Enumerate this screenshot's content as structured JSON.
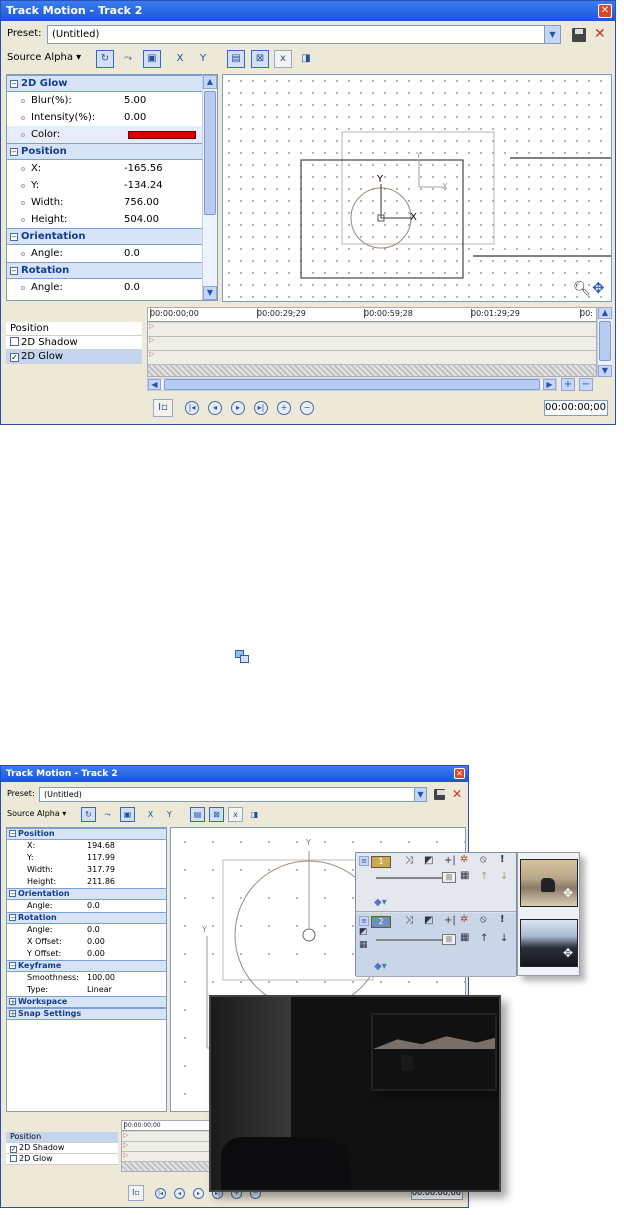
{
  "top_window": {
    "title": "Track Motion - Track 2",
    "preset_label": "Preset:",
    "preset_value": "(Untitled)",
    "source_alpha_label": "Source Alpha",
    "sections": [
      {
        "title": "2D Glow",
        "rows": [
          {
            "label": "Blur(%):",
            "value": "5.00"
          },
          {
            "label": "Intensity(%):",
            "value": "0.00"
          },
          {
            "label": "Color:",
            "value": ""
          }
        ]
      },
      {
        "title": "Position",
        "rows": [
          {
            "label": "X:",
            "value": "-165.56"
          },
          {
            "label": "Y:",
            "value": "-134.24"
          },
          {
            "label": "Width:",
            "value": "756.00"
          },
          {
            "label": "Height:",
            "value": "504.00"
          }
        ]
      },
      {
        "title": "Orientation",
        "rows": [
          {
            "label": "Angle:",
            "value": "0.0"
          }
        ]
      },
      {
        "title": "Rotation",
        "rows": [
          {
            "label": "Angle:",
            "value": "0.0"
          }
        ]
      }
    ],
    "canvas": {
      "axis_y": "Y",
      "axis_x": "X",
      "axis_y2": "Y",
      "axis_x2": "X"
    },
    "tracks": [
      {
        "label": "Position",
        "checked": null
      },
      {
        "label": "2D Shadow",
        "checked": false
      },
      {
        "label": "2D Glow",
        "checked": true
      }
    ],
    "ruler": [
      "00:00:00;00",
      "00:00:29;29",
      "00:00:59;28",
      "00:01:29;29",
      "00:"
    ],
    "timecode": "00:00:00;00",
    "glow_color": "#e00000"
  },
  "bottom_window": {
    "title": "Track Motion - Track 2",
    "preset_label": "Preset:",
    "preset_value": "(Untitled)",
    "source_alpha_label": "Source Alpha",
    "sections": [
      {
        "title": "Position",
        "expanded": true,
        "rows": [
          {
            "label": "X:",
            "value": "194.68"
          },
          {
            "label": "Y:",
            "value": "117.99"
          },
          {
            "label": "Width:",
            "value": "317.79"
          },
          {
            "label": "Height:",
            "value": "211.86"
          }
        ]
      },
      {
        "title": "Orientation",
        "expanded": true,
        "rows": [
          {
            "label": "Angle:",
            "value": "0.0"
          }
        ]
      },
      {
        "title": "Rotation",
        "expanded": true,
        "rows": [
          {
            "label": "Angle:",
            "value": "0.0"
          },
          {
            "label": "X Offset:",
            "value": "0.00"
          },
          {
            "label": "Y Offset:",
            "value": "0.00"
          }
        ]
      },
      {
        "title": "Keyframe",
        "expanded": true,
        "rows": [
          {
            "label": "Smoothness:",
            "value": "100.00"
          },
          {
            "label": "Type:",
            "value": "Linear"
          }
        ]
      },
      {
        "title": "Workspace",
        "expanded": false,
        "rows": []
      },
      {
        "title": "Snap Settings",
        "expanded": false,
        "rows": []
      }
    ],
    "canvas": {
      "axis_y": "Y",
      "axis_y_left": "Y"
    },
    "tracks": [
      {
        "label": "Position",
        "checked": null
      },
      {
        "label": "2D Shadow",
        "checked": true
      },
      {
        "label": "2D Glow",
        "checked": false
      }
    ],
    "ruler": [
      "00:00:00;00"
    ],
    "timecode": "00:00:00;06",
    "bus": {
      "track1": "1",
      "track2": "2"
    }
  }
}
